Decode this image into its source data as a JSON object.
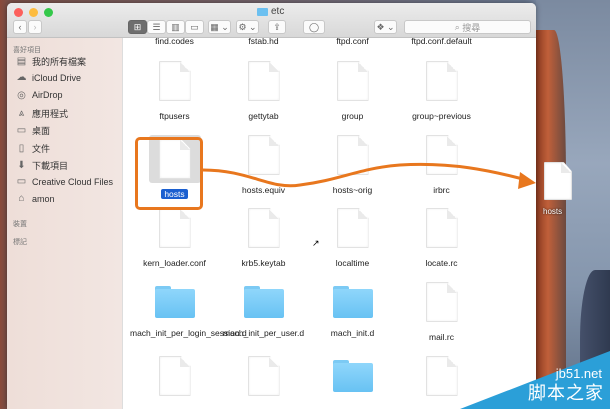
{
  "window": {
    "title": "etc"
  },
  "toolbar": {
    "back": "‹",
    "forward": "›",
    "view_icons": "⊞",
    "view_list": "☰",
    "view_columns": "▥",
    "view_gallery": "▭",
    "arrange": "▦ ⌄",
    "action": "⚙ ⌄",
    "share": "⇪",
    "tag": "◯",
    "dropbox": "❖ ⌄",
    "search_placeholder": "搜尋"
  },
  "sidebar": {
    "favorites_header": "喜好項目",
    "items": [
      {
        "label": "我的所有檔案",
        "icon": "all-files-icon",
        "glyph": "▤"
      },
      {
        "label": "iCloud Drive",
        "icon": "cloud-icon",
        "glyph": "☁"
      },
      {
        "label": "AirDrop",
        "icon": "airdrop-icon",
        "glyph": "◎"
      },
      {
        "label": "應用程式",
        "icon": "applications-icon",
        "glyph": "⩓"
      },
      {
        "label": "桌面",
        "icon": "desktop-icon",
        "glyph": "▭"
      },
      {
        "label": "文件",
        "icon": "documents-icon",
        "glyph": "▯"
      },
      {
        "label": "下載項目",
        "icon": "downloads-icon",
        "glyph": "⬇"
      },
      {
        "label": "Creative Cloud Files",
        "icon": "folder-icon",
        "glyph": "▭"
      },
      {
        "label": "amon",
        "icon": "home-icon",
        "glyph": "⌂"
      }
    ],
    "devices_header": "裝置",
    "tags_header": "標記"
  },
  "files": [
    {
      "name": "find.codes",
      "type": "file"
    },
    {
      "name": "fstab.hd",
      "type": "file"
    },
    {
      "name": "ftpd.conf",
      "type": "file"
    },
    {
      "name": "ftpd.conf.default",
      "type": "file"
    },
    {
      "name": "ftpusers",
      "type": "file"
    },
    {
      "name": "gettytab",
      "type": "file"
    },
    {
      "name": "group",
      "type": "file"
    },
    {
      "name": "group~previous",
      "type": "file"
    },
    {
      "name": "hosts",
      "type": "file",
      "selected": true
    },
    {
      "name": "hosts.equiv",
      "type": "file"
    },
    {
      "name": "hosts~orig",
      "type": "file"
    },
    {
      "name": "irbrc",
      "type": "file"
    },
    {
      "name": "kern_loader.conf",
      "type": "file"
    },
    {
      "name": "krb5.keytab",
      "type": "file"
    },
    {
      "name": "localtime",
      "type": "alias"
    },
    {
      "name": "locate.rc",
      "type": "file"
    },
    {
      "name": "mach_init_per_login_session.d",
      "type": "folder"
    },
    {
      "name": "mach_init_per_user.d",
      "type": "folder"
    },
    {
      "name": "mach_init.d",
      "type": "folder"
    },
    {
      "name": "mail.rc",
      "type": "file"
    },
    {
      "name": "",
      "type": "file"
    },
    {
      "name": "",
      "type": "file"
    },
    {
      "name": "",
      "type": "folder"
    },
    {
      "name": "",
      "type": "file"
    }
  ],
  "desktop": {
    "file_label": "hosts"
  },
  "annotation": {
    "color": "#e8771e"
  },
  "watermark": {
    "line1": "jb51.net",
    "line2": "脚本之家"
  }
}
